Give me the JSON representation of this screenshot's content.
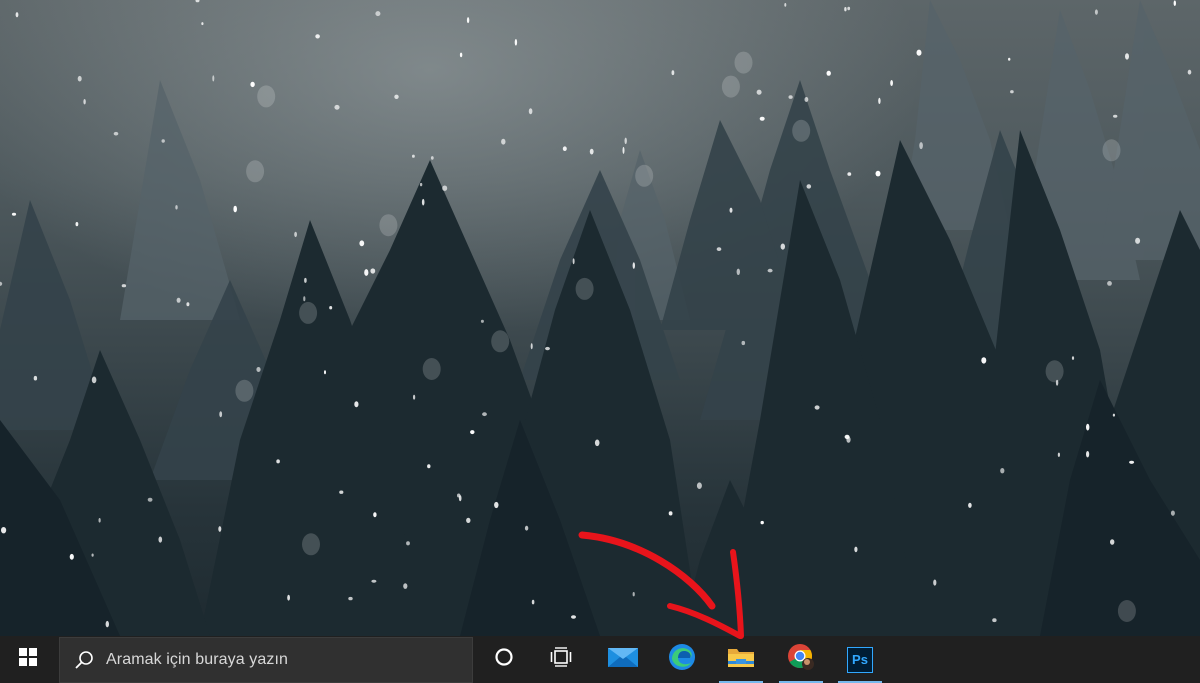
{
  "taskbar": {
    "search": {
      "placeholder": "Aramak için buraya yazın"
    },
    "icons": {
      "start": "windows-start-icon",
      "search": "search-icon",
      "cortana": "cortana-circle-icon",
      "task_view": "task-view-icon",
      "mail": "mail-icon",
      "edge": "edge-icon",
      "file_explorer": "file-explorer-icon",
      "chrome": "chrome-icon",
      "photoshop": "photoshop-icon"
    },
    "photoshop_label": "Ps",
    "running_indicator_color": "#76b9ed",
    "background_color": "#202020"
  },
  "annotation": {
    "arrow_color": "#e8141b",
    "points_to": "file-explorer-button"
  },
  "desktop": {
    "wallpaper": "snowy misty pine forest"
  }
}
